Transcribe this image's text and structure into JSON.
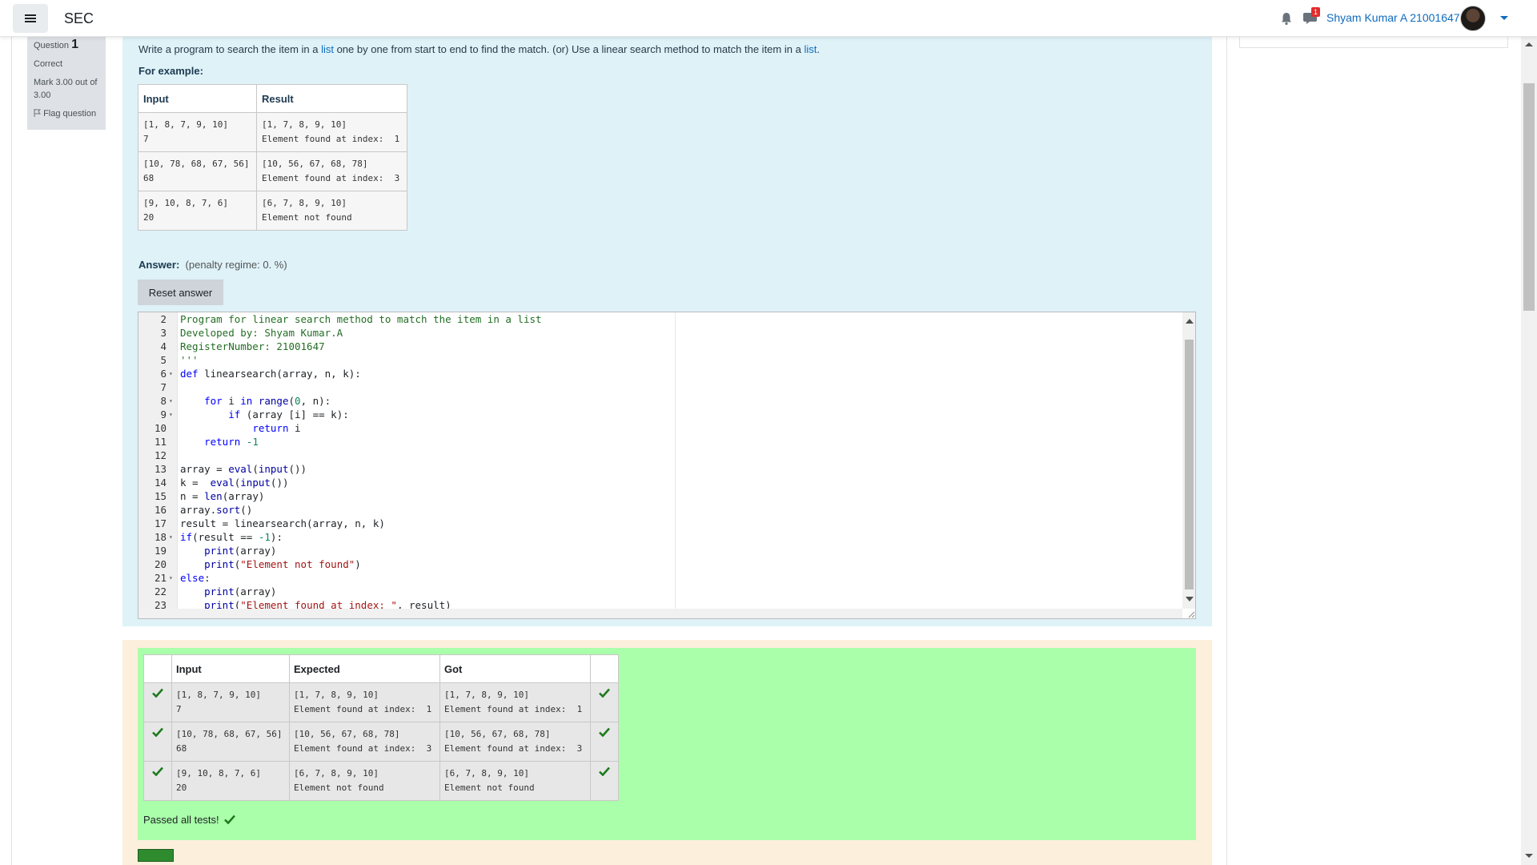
{
  "navbar": {
    "brand": "SEC",
    "user_name": "Shyam Kumar A 21001647",
    "notification_count": "1"
  },
  "question_info": {
    "question_label": "Question",
    "question_number": "1",
    "state": "Correct",
    "mark": "Mark 3.00 out of 3.00",
    "flag_label": "Flag question"
  },
  "question": {
    "text_part1": "Write a program to search the item in a ",
    "link1": "list",
    "text_part2": " one by one from start to end to find the match. (or) Use a linear search method to match the item in a ",
    "link2": "list",
    "text_part3": ".",
    "for_example": "For example:",
    "example_headers": [
      "Input",
      "Result"
    ],
    "examples": [
      {
        "input": "[1, 8, 7, 9, 10]\n7",
        "result": "[1, 7, 8, 9, 10]\nElement found at index:  1"
      },
      {
        "input": "[10, 78, 68, 67, 56]\n68",
        "result": "[10, 56, 67, 68, 78]\nElement found at index:  3"
      },
      {
        "input": "[9, 10, 8, 7, 6]\n20",
        "result": "[6, 7, 8, 9, 10]\nElement not found"
      }
    ]
  },
  "answer": {
    "label": "Answer:",
    "penalty": "(penalty regime: 0. %)",
    "reset_label": "Reset answer"
  },
  "code_lines": [
    {
      "n": "2",
      "fold": false,
      "parts": [
        [
          "cm",
          "Program for linear search method to match the item in a list"
        ]
      ]
    },
    {
      "n": "3",
      "fold": false,
      "parts": [
        [
          "cm",
          "Developed by: Shyam Kumar.A"
        ]
      ]
    },
    {
      "n": "4",
      "fold": false,
      "parts": [
        [
          "cm",
          "RegisterNumber: 21001647"
        ]
      ]
    },
    {
      "n": "5",
      "fold": false,
      "parts": [
        [
          "cm",
          "'''"
        ]
      ]
    },
    {
      "n": "6",
      "fold": true,
      "parts": [
        [
          "kw",
          "def"
        ],
        [
          "",
          " linearsearch(array, n, k):"
        ]
      ]
    },
    {
      "n": "7",
      "fold": false,
      "parts": []
    },
    {
      "n": "8",
      "fold": true,
      "parts": [
        [
          "",
          "    "
        ],
        [
          "kw",
          "for"
        ],
        [
          "",
          " i "
        ],
        [
          "kw",
          "in"
        ],
        [
          "",
          " "
        ],
        [
          "bi",
          "range"
        ],
        [
          "",
          "("
        ],
        [
          "num",
          "0"
        ],
        [
          "",
          ", n):"
        ]
      ]
    },
    {
      "n": "9",
      "fold": true,
      "parts": [
        [
          "",
          "        "
        ],
        [
          "kw",
          "if"
        ],
        [
          "",
          " (array [i] == k):"
        ]
      ]
    },
    {
      "n": "10",
      "fold": false,
      "parts": [
        [
          "",
          "            "
        ],
        [
          "kw",
          "return"
        ],
        [
          "",
          " i"
        ]
      ]
    },
    {
      "n": "11",
      "fold": false,
      "parts": [
        [
          "",
          "    "
        ],
        [
          "kw",
          "return"
        ],
        [
          "",
          " "
        ],
        [
          "num",
          "-1"
        ]
      ]
    },
    {
      "n": "12",
      "fold": false,
      "parts": []
    },
    {
      "n": "13",
      "fold": false,
      "parts": [
        [
          "",
          "array = "
        ],
        [
          "bi",
          "eval"
        ],
        [
          "",
          "("
        ],
        [
          "bi",
          "input"
        ],
        [
          "",
          "())"
        ]
      ]
    },
    {
      "n": "14",
      "fold": false,
      "parts": [
        [
          "",
          "k =  "
        ],
        [
          "bi",
          "eval"
        ],
        [
          "",
          "("
        ],
        [
          "bi",
          "input"
        ],
        [
          "",
          "())"
        ]
      ]
    },
    {
      "n": "15",
      "fold": false,
      "parts": [
        [
          "",
          "n = "
        ],
        [
          "bi",
          "len"
        ],
        [
          "",
          "(array)"
        ]
      ]
    },
    {
      "n": "16",
      "fold": false,
      "parts": [
        [
          "",
          "array."
        ],
        [
          "bi",
          "sort"
        ],
        [
          "",
          "()"
        ]
      ]
    },
    {
      "n": "17",
      "fold": false,
      "parts": [
        [
          "",
          "result = linearsearch(array, n, k)"
        ]
      ]
    },
    {
      "n": "18",
      "fold": true,
      "parts": [
        [
          "kw",
          "if"
        ],
        [
          "",
          "(result == "
        ],
        [
          "num",
          "-1"
        ],
        [
          "",
          "):"
        ]
      ]
    },
    {
      "n": "19",
      "fold": false,
      "parts": [
        [
          "",
          "    "
        ],
        [
          "bi",
          "print"
        ],
        [
          "",
          "(array)"
        ]
      ]
    },
    {
      "n": "20",
      "fold": false,
      "parts": [
        [
          "",
          "    "
        ],
        [
          "bi",
          "print"
        ],
        [
          "",
          "("
        ],
        [
          "str",
          "\"Element not found\""
        ],
        [
          "",
          ")"
        ]
      ]
    },
    {
      "n": "21",
      "fold": true,
      "parts": [
        [
          "kw",
          "else"
        ],
        [
          "",
          ":"
        ]
      ]
    },
    {
      "n": "22",
      "fold": false,
      "parts": [
        [
          "",
          "    "
        ],
        [
          "bi",
          "print"
        ],
        [
          "",
          "(array)"
        ]
      ]
    },
    {
      "n": "23",
      "fold": false,
      "parts": [
        [
          "",
          "    "
        ],
        [
          "bi",
          "print"
        ],
        [
          "",
          "("
        ],
        [
          "str",
          "\"Element found at index: \""
        ],
        [
          "",
          ", result)"
        ]
      ]
    }
  ],
  "results": {
    "headers": [
      "",
      "Input",
      "Expected",
      "Got",
      ""
    ],
    "rows": [
      {
        "input": "[1, 8, 7, 9, 10]\n7",
        "expected": "[1, 7, 8, 9, 10]\nElement found at index:  1",
        "got": "[1, 7, 8, 9, 10]\nElement found at index:  1"
      },
      {
        "input": "[10, 78, 68, 67, 56]\n68",
        "expected": "[10, 56, 67, 68, 78]\nElement found at index:  3",
        "got": "[10, 56, 67, 68, 78]\nElement found at index:  3"
      },
      {
        "input": "[9, 10, 8, 7, 6]\n20",
        "expected": "[6, 7, 8, 9, 10]\nElement not found",
        "got": "[6, 7, 8, 9, 10]\nElement not found"
      }
    ],
    "passed_label": "Passed all tests!"
  },
  "colors": {
    "accent": "#0f6cbf",
    "formulation_bg": "#def2f8",
    "outcome_bg": "#fcefdc",
    "pass_green": "#aaffaa",
    "check_green": "#1e7b1e"
  }
}
